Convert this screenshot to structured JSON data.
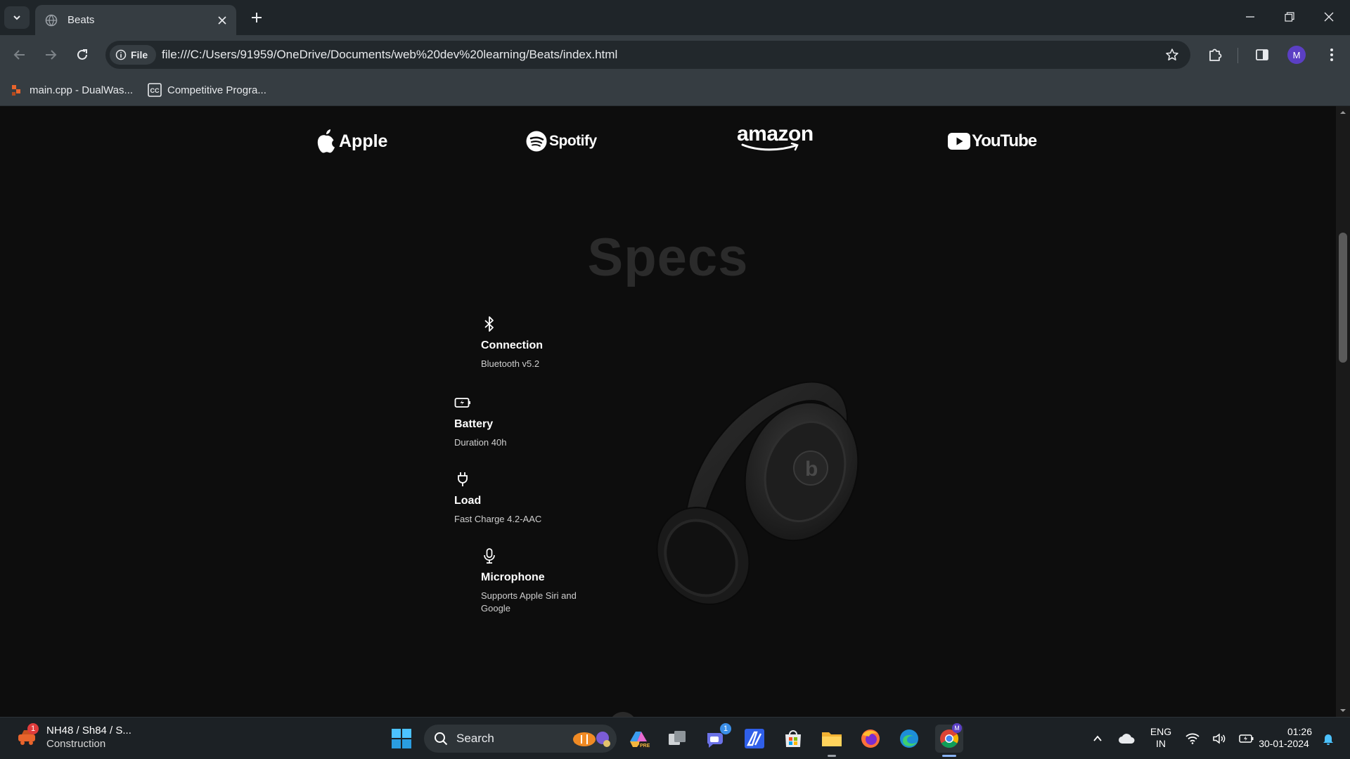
{
  "browser": {
    "tab_title": "Beats",
    "url": "file:///C:/Users/91959/OneDrive/Documents/web%20dev%20learning/Beats/index.html",
    "site_chip_label": "File",
    "profile_initial": "M",
    "bookmarks": [
      {
        "label": "main.cpp - DualWas..."
      },
      {
        "label": "Competitive Progra..."
      }
    ]
  },
  "page": {
    "brands": [
      "Apple",
      "Spotify",
      "amazon",
      "YouTube"
    ],
    "specs_title": "Specs",
    "specs": [
      {
        "icon": "bluetooth-icon",
        "name": "Connection",
        "value": "Bluetooth v5.2"
      },
      {
        "icon": "battery-charging-icon",
        "name": "Battery",
        "value": "Duration 40h"
      },
      {
        "icon": "plug-icon",
        "name": "Load",
        "value": "Fast Charge 4.2-AAC"
      },
      {
        "icon": "microphone-icon",
        "name": "Microphone",
        "value": "Supports Apple Siri and Google"
      }
    ]
  },
  "taskbar": {
    "weather_title": "NH48 / Sh84 / S...",
    "weather_subtitle": "Construction",
    "weather_badge": "1",
    "search_label": "Search",
    "teams_badge": "1",
    "lang_line1": "ENG",
    "lang_line2": "IN",
    "time": "01:26",
    "date": "30-01-2024"
  },
  "colors": {
    "page_bg": "#0d0d0d",
    "specs_title": "#2b2b2b",
    "chrome_bg": "#363d42",
    "accent": "#8ab4f8"
  }
}
